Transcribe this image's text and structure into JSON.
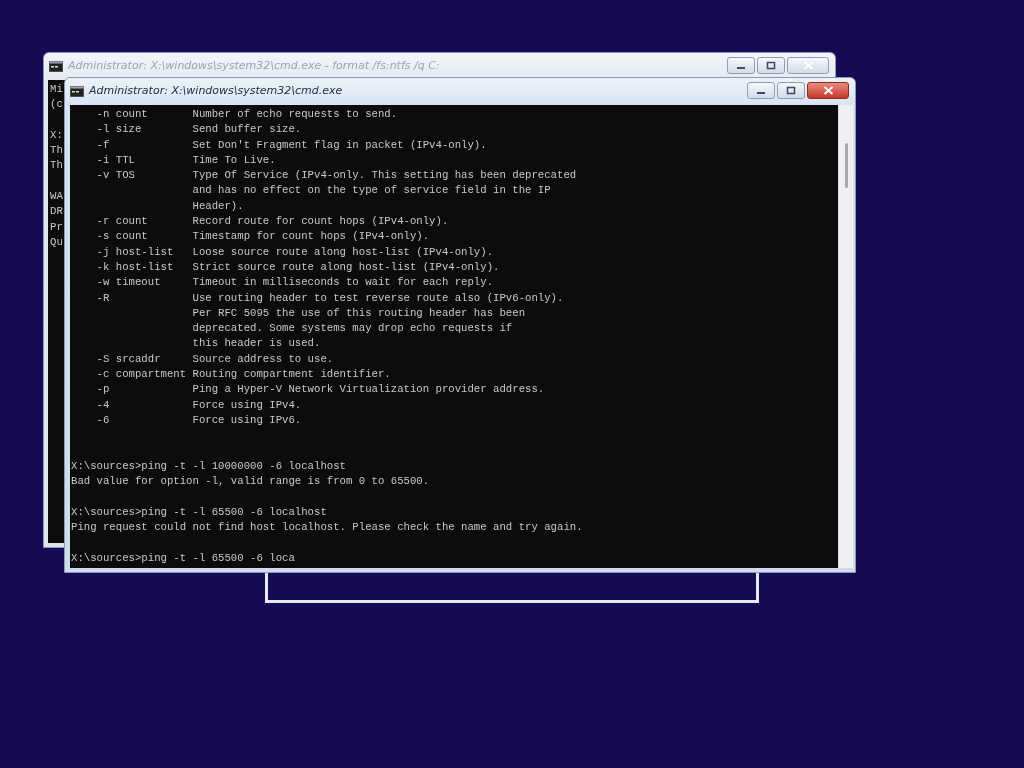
{
  "back_window": {
    "title": "Administrator: X:\\windows\\system32\\cmd.exe - format /fs:ntfs /q C:",
    "active": false,
    "console_groups": [
      [
        "Mi",
        "(c"
      ],
      [
        "X:",
        "Th",
        "Th"
      ],
      [
        "WA",
        "DR",
        "Pr",
        "Qu"
      ]
    ]
  },
  "front_window": {
    "title": "Administrator: X:\\windows\\system32\\cmd.exe",
    "active": true,
    "help_lines": [
      "    -n count       Number of echo requests to send.",
      "    -l size        Send buffer size.",
      "    -f             Set Don't Fragment flag in packet (IPv4-only).",
      "    -i TTL         Time To Live.",
      "    -v TOS         Type Of Service (IPv4-only. This setting has been deprecated",
      "                   and has no effect on the type of service field in the IP",
      "                   Header).",
      "    -r count       Record route for count hops (IPv4-only).",
      "    -s count       Timestamp for count hops (IPv4-only).",
      "    -j host-list   Loose source route along host-list (IPv4-only).",
      "    -k host-list   Strict source route along host-list (IPv4-only).",
      "    -w timeout     Timeout in milliseconds to wait for each reply.",
      "    -R             Use routing header to test reverse route also (IPv6-only).",
      "                   Per RFC 5095 the use of this routing header has been",
      "                   deprecated. Some systems may drop echo requests if",
      "                   this header is used.",
      "    -S srcaddr     Source address to use.",
      "    -c compartment Routing compartment identifier.",
      "    -p             Ping a Hyper-V Network Virtualization provider address.",
      "    -4             Force using IPv4.",
      "    -6             Force using IPv6."
    ],
    "sessions": [
      {
        "command": "X:\\sources>ping -t -l 10000000 -6 localhost",
        "output": "Bad value for option -l, valid range is from 0 to 65500."
      },
      {
        "command": "X:\\sources>ping -t -l 65500 -6 localhost",
        "output": "Ping request could not find host localhost. Please check the name and try again."
      },
      {
        "command": "X:\\sources>ping -t -l 65500 -6 loca"
      }
    ]
  }
}
